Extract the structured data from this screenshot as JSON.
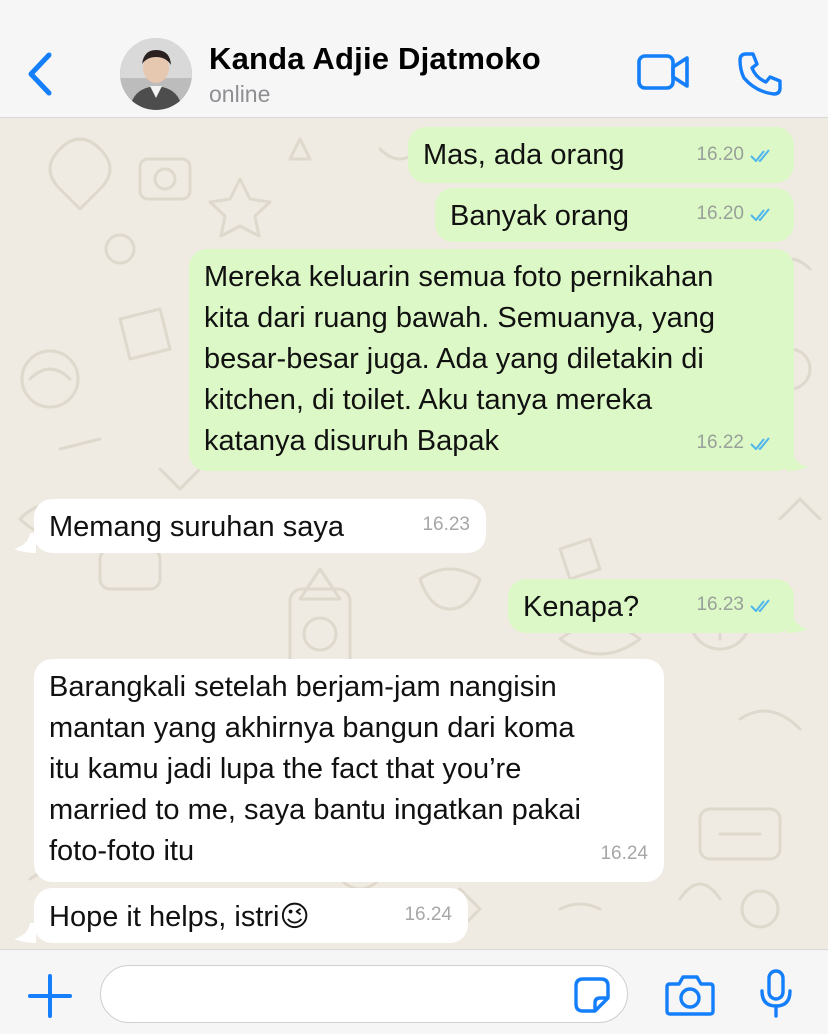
{
  "header": {
    "contact_name": "Kanda Adjie Djatmoko",
    "status": "online",
    "icons": [
      "chevron-left-icon",
      "avatar",
      "video-call-icon",
      "phone-icon"
    ]
  },
  "messages": [
    {
      "direction": "out",
      "text": "Mas, ada orang",
      "time": "16.20",
      "read": true
    },
    {
      "direction": "out",
      "text": "Banyak orang",
      "time": "16.20",
      "read": true
    },
    {
      "direction": "out",
      "text": "Mereka keluarin semua foto pernikahan\nkita dari ruang bawah. Semuanya, yang\nbesar-besar juga. Ada yang diletakin di\nkitchen, di toilet. Aku tanya mereka\nkatanya disuruh Bapak",
      "time": "16.22",
      "read": true
    },
    {
      "direction": "in",
      "text": "Memang suruhan saya",
      "time": "16.23"
    },
    {
      "direction": "out",
      "text": "Kenapa?",
      "time": "16.23",
      "read": true
    },
    {
      "direction": "in",
      "text": "Barangkali setelah berjam-jam nangisin\nmantan yang akhirnya bangun dari koma\nitu kamu jadi lupa the fact that you’re\nmarried to me, saya bantu ingatkan pakai\nfoto-foto itu",
      "time": "16.24"
    },
    {
      "direction": "in",
      "text": "Hope it helps, istri",
      "emoji": "😉",
      "time": "16.24"
    }
  ],
  "composer": {
    "placeholder": "",
    "icons": [
      "plus-icon",
      "sticker-icon",
      "camera-icon",
      "microphone-icon"
    ]
  },
  "colors": {
    "accent": "#147efb",
    "outgoing_bubble": "#dcf8c6",
    "incoming_bubble": "#ffffff",
    "read_ticks": "#4fb6ec",
    "background": "#efeae2"
  }
}
